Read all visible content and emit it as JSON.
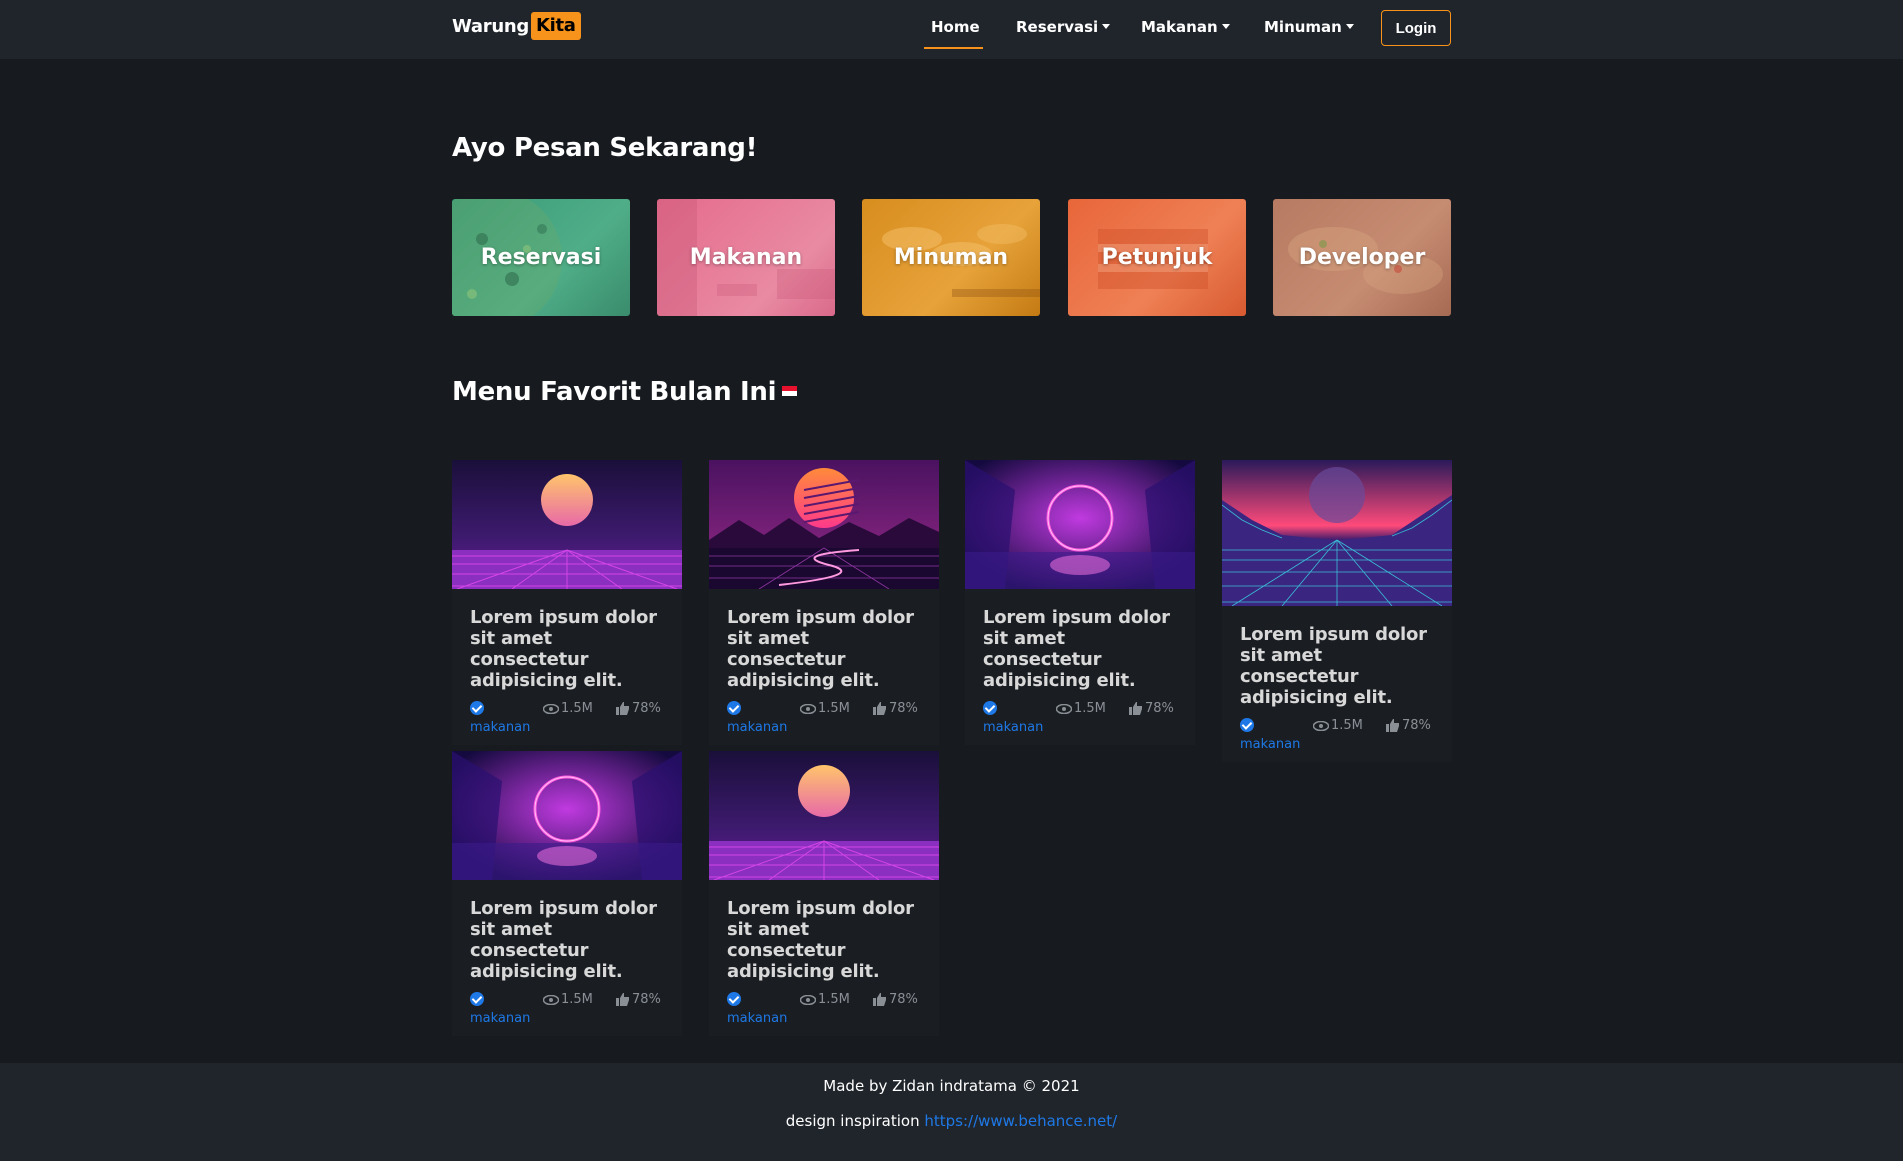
{
  "colors": {
    "accent": "#f7931a",
    "link": "#1e78e6",
    "background": "#171b20",
    "navbar": "#20252b"
  },
  "brand": {
    "part1": "Warung",
    "part2": "Kita"
  },
  "nav": {
    "home": "Home",
    "reservasi": "Reservasi",
    "makanan": "Makanan",
    "minuman": "Minuman",
    "login": "Login"
  },
  "order_section": {
    "title": "Ayo Pesan Sekarang!",
    "tiles": [
      {
        "label": "Reservasi"
      },
      {
        "label": "Makanan"
      },
      {
        "label": "Minuman"
      },
      {
        "label": "Petunjuk"
      },
      {
        "label": "Developer"
      }
    ]
  },
  "favorite_section": {
    "title": "Menu Favorit Bulan Ini",
    "flag_icon": "indonesia-flag-icon",
    "cards": [
      {
        "title": "Lorem ipsum dolor sit amet consectetur adipisicing elit.",
        "category": "makanan",
        "views": "1.5M",
        "likes": "78%"
      },
      {
        "title": "Lorem ipsum dolor sit amet consectetur adipisicing elit.",
        "category": "makanan",
        "views": "1.5M",
        "likes": "78%"
      },
      {
        "title": "Lorem ipsum dolor sit amet consectetur adipisicing elit.",
        "category": "makanan",
        "views": "1.5M",
        "likes": "78%"
      },
      {
        "title": "Lorem ipsum dolor sit amet consectetur adipisicing elit.",
        "category": "makanan",
        "views": "1.5M",
        "likes": "78%"
      },
      {
        "title": "Lorem ipsum dolor sit amet consectetur adipisicing elit.",
        "category": "makanan",
        "views": "1.5M",
        "likes": "78%"
      },
      {
        "title": "Lorem ipsum dolor sit amet consectetur adipisicing elit.",
        "category": "makanan",
        "views": "1.5M",
        "likes": "78%"
      }
    ]
  },
  "footer": {
    "credit": "Made by Zidan indratama © 2021",
    "inspiration_label": "design inspiration",
    "inspiration_link": "https://www.behance.net/"
  }
}
